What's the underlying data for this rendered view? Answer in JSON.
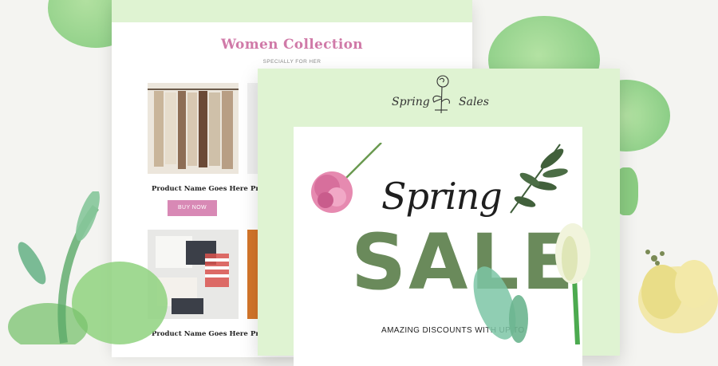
{
  "colors": {
    "accent_pink": "#d889b5",
    "title_pink": "#d07aa8",
    "sale_green": "#6a8a5b",
    "card_green": "#dff3d2"
  },
  "women_collection": {
    "title": "Women Collection",
    "subtitle": "SPECIALLY FOR HER",
    "products": [
      {
        "name": "Product Name Goes Here",
        "button": "BUY NOW"
      },
      {
        "name": "Pr"
      },
      {
        "name": "Product Name Goes Here"
      },
      {
        "name": "Pr"
      }
    ]
  },
  "spring_sales": {
    "header_left": "Spring",
    "header_right": "Sales",
    "script_word": "Spring",
    "big_word": "SALE",
    "discount_line": "AMAZING DISCOUNTS WITH UP TO"
  }
}
